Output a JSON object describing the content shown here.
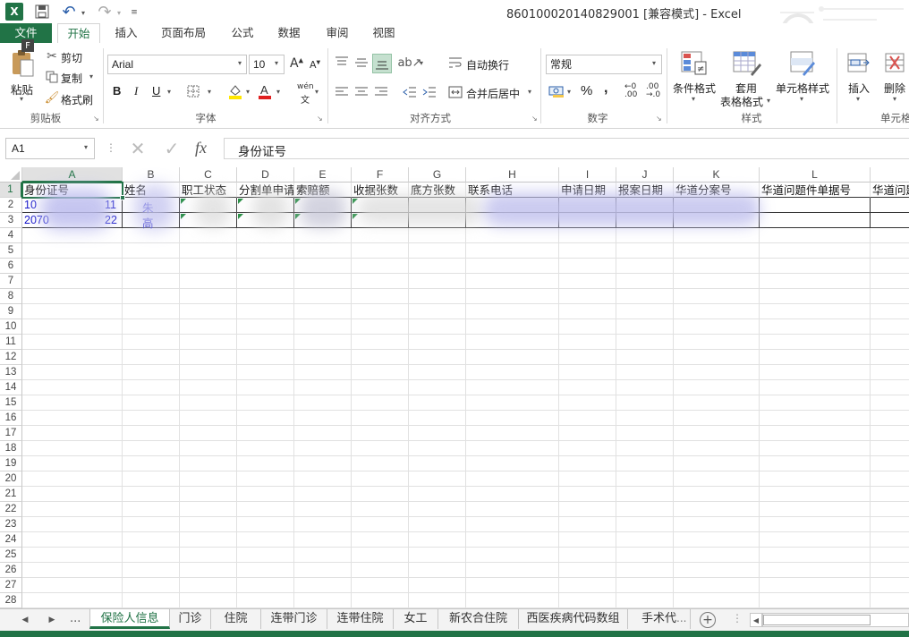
{
  "window": {
    "title": "860100020140829001  [兼容模式] - Excel"
  },
  "ribbon_tabs": [
    "文件",
    "开始",
    "插入",
    "页面布局",
    "公式",
    "数据",
    "审阅",
    "视图"
  ],
  "key_tip": "F",
  "clipboard": {
    "paste": "粘贴",
    "cut": "剪切",
    "copy": "复制",
    "format_painter": "格式刷",
    "group": "剪贴板"
  },
  "font": {
    "name": "Arial",
    "size": "10",
    "bold": "B",
    "italic": "I",
    "underline": "U",
    "phonetic": "wén",
    "group": "字体"
  },
  "alignment": {
    "wrap_text": "自动换行",
    "merge_center": "合并后居中",
    "group": "对齐方式"
  },
  "number": {
    "format": "常规",
    "percent": "%",
    "comma": ",",
    "group": "数字"
  },
  "styles": {
    "conditional": "条件格式",
    "table_line1": "套用",
    "table_line2": "表格格式",
    "cell_styles": "单元格样式",
    "group": "样式"
  },
  "cells": {
    "insert": "插入",
    "delete": "删除",
    "group": "单元格"
  },
  "formula_bar": {
    "name_box": "A1",
    "fx": "fx",
    "content": "身份证号"
  },
  "columns": [
    "A",
    "B",
    "C",
    "D",
    "E",
    "F",
    "G",
    "H",
    "I",
    "J",
    "K",
    "L",
    ""
  ],
  "row_numbers": [
    "1",
    "2",
    "3",
    "4",
    "5",
    "6",
    "7",
    "8",
    "9",
    "10",
    "11",
    "12",
    "13",
    "14",
    "15",
    "16",
    "17",
    "18",
    "19",
    "20",
    "21",
    "22",
    "23",
    "24",
    "25",
    "26",
    "27",
    "28"
  ],
  "headers": [
    "身份证号",
    "姓名",
    "职工状态",
    "分割单申请",
    "索赔额",
    "收据张数",
    "底方张数",
    "联系电话",
    "申请日期",
    "报案日期",
    "华道分案号",
    "华道问题件单据号",
    "华道问题"
  ],
  "rows": [
    [
      "10",
      "11",
      "朱"
    ],
    [
      "2070",
      "22",
      "高"
    ]
  ],
  "sheet_tabs": [
    "保险人信息",
    "门诊",
    "住院",
    "连带门诊",
    "连带住院",
    "女工",
    "新农合住院",
    "西医疾病代码数组",
    "手术代"
  ],
  "sheet_more": "...",
  "colors": {
    "excel_green": "#217346",
    "tab_active": "#e6f2ea",
    "selection": "#217346",
    "blur_blue": "#c8c8f0"
  }
}
